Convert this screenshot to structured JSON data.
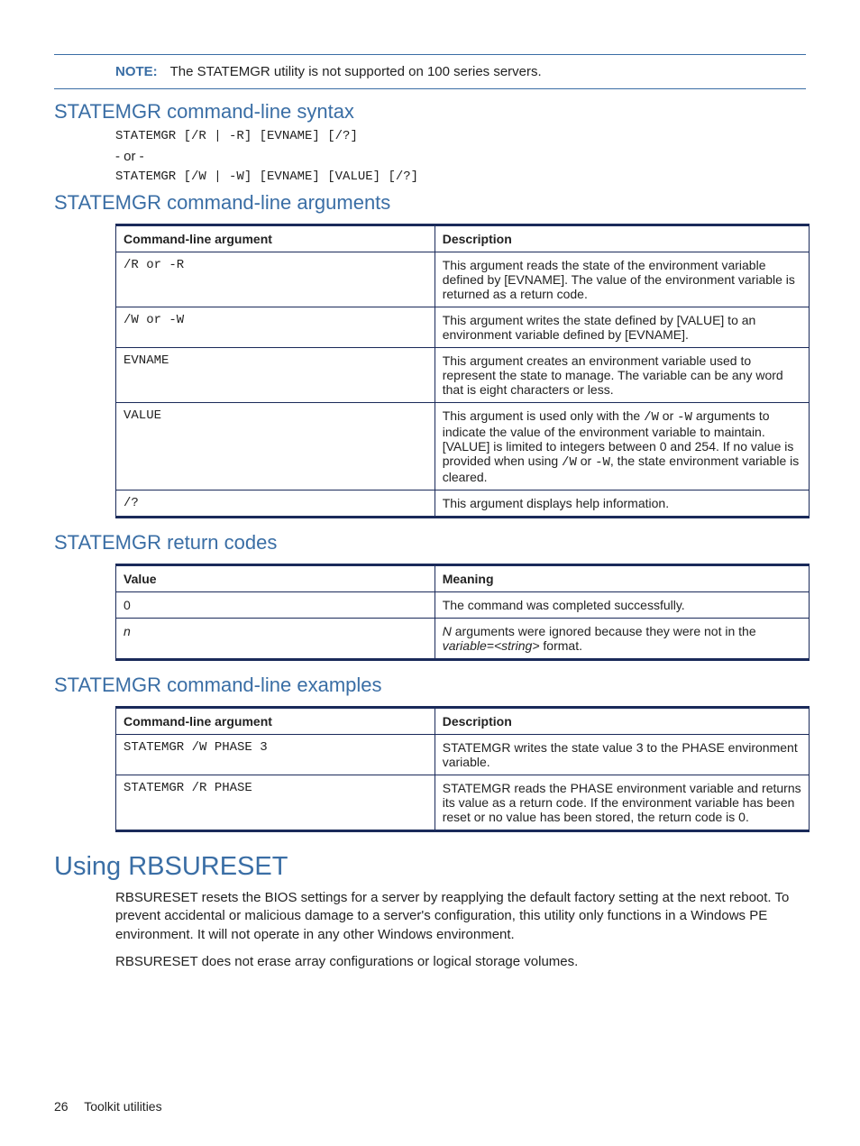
{
  "note": {
    "label": "NOTE:",
    "text": "The STATEMGR utility is not supported on 100 series servers."
  },
  "syntax": {
    "heading": "STATEMGR command-line syntax",
    "line1": "STATEMGR [/R | -R] [EVNAME] [/?]",
    "or": "- or -",
    "line2": "STATEMGR [/W | -W] [EVNAME] [VALUE] [/?]"
  },
  "args": {
    "heading": "STATEMGR command-line arguments",
    "th1": "Command-line argument",
    "th2": "Description",
    "rows": [
      {
        "arg": "/R or -R",
        "desc": "This argument reads the state of the environment variable defined by [EVNAME]. The value of the environment variable is returned as a return code."
      },
      {
        "arg": "/W or -W",
        "desc": "This argument writes the state defined by [VALUE] to an environment variable defined by [EVNAME]."
      },
      {
        "arg": "EVNAME",
        "desc": "This argument creates an environment variable used to represent the state to manage. The variable can be any word that is eight characters or less."
      },
      {
        "arg": "VALUE",
        "desc_pre": "This argument is used only with the ",
        "desc_code1": "/W",
        "desc_mid1": " or ",
        "desc_code2": "-W",
        "desc_mid2": " arguments to indicate the value of the environment variable to maintain. [VALUE] is limited to integers between 0 and 254. If no value is provided when using ",
        "desc_code3": "/W",
        "desc_mid3": " or ",
        "desc_code4": "-W",
        "desc_post": ", the state environment variable is cleared."
      },
      {
        "arg": "/?",
        "desc": "This argument displays help information."
      }
    ]
  },
  "returns": {
    "heading": "STATEMGR return codes",
    "th1": "Value",
    "th2": "Meaning",
    "rows": [
      {
        "val": "0",
        "mean": "The command was completed successfully."
      },
      {
        "val": "n",
        "mean_pre": "N",
        "mean_mid": " arguments were ignored because they were not in the ",
        "mean_code": "variable=<string>",
        "mean_post": " format."
      }
    ]
  },
  "examples": {
    "heading": "STATEMGR command-line examples",
    "th1": "Command-line argument",
    "th2": "Description",
    "rows": [
      {
        "cmd": "STATEMGR /W PHASE 3",
        "desc": "STATEMGR writes the state value 3 to the PHASE environment variable."
      },
      {
        "cmd": "STATEMGR /R PHASE",
        "desc": "STATEMGR reads the PHASE environment variable and returns its value as a return code. If the environment variable has been reset or no value has been stored, the return code is 0."
      }
    ]
  },
  "rbsureset": {
    "heading": "Using RBSURESET",
    "p1": "RBSURESET resets the BIOS settings for a server by reapplying the default factory setting at the next reboot. To prevent accidental or malicious damage to a server's configuration, this utility only functions in a Windows PE environment. It will not operate in any other Windows environment.",
    "p2": "RBSURESET does not erase array configurations or logical storage volumes."
  },
  "footer": {
    "page": "26",
    "title": "Toolkit utilities"
  }
}
